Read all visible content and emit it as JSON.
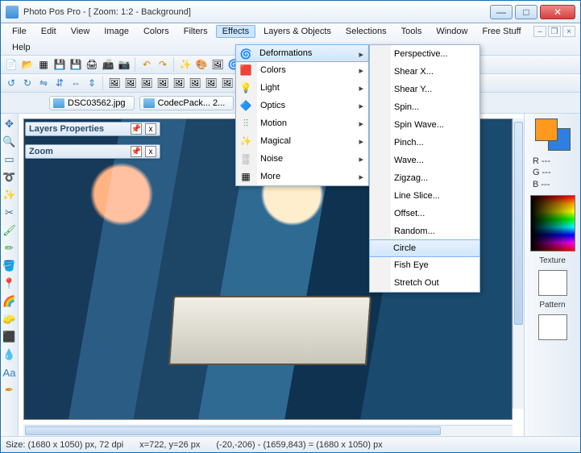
{
  "window": {
    "title": "Photo Pos Pro - [ Zoom: 1:2 - Background]"
  },
  "menu": {
    "file": "File",
    "edit": "Edit",
    "view": "View",
    "image": "Image",
    "colors": "Colors",
    "filters": "Filters",
    "effects": "Effects",
    "layers": "Layers & Objects",
    "selections": "Selections",
    "tools": "Tools",
    "window": "Window",
    "freestuff": "Free Stuff",
    "help": "Help"
  },
  "tabs": {
    "a": "DSC03562.jpg",
    "b": "CodecPack... 2..."
  },
  "floating": {
    "layers": "Layers Properties",
    "zoom": "Zoom",
    "close": "x"
  },
  "effects_menu": {
    "deformations": "Deformations",
    "colors": "Colors",
    "light": "Light",
    "optics": "Optics",
    "motion": "Motion",
    "magical": "Magical",
    "noise": "Noise",
    "more": "More"
  },
  "def_menu": {
    "perspective": "Perspective...",
    "shearx": "Shear X...",
    "sheary": "Shear Y...",
    "spin": "Spin...",
    "spinwave": "Spin Wave...",
    "pinch": "Pinch...",
    "wave": "Wave...",
    "zigzag": "Zigzag...",
    "lineslice": "Line Slice...",
    "offset": "Offset...",
    "random": "Random...",
    "circle": "Circle",
    "fisheye": "Fish Eye",
    "stretch": "Stretch Out"
  },
  "right": {
    "r": "R ---",
    "g": "G ---",
    "b": "B ---",
    "texture": "Texture",
    "pattern": "Pattern"
  },
  "status": {
    "size": "Size: (1680 x 1050) px, 72 dpi",
    "xy": "x=722, y=26 px",
    "sel": "(-20,-206) - (1659,843) = (1680 x 1050) px"
  }
}
